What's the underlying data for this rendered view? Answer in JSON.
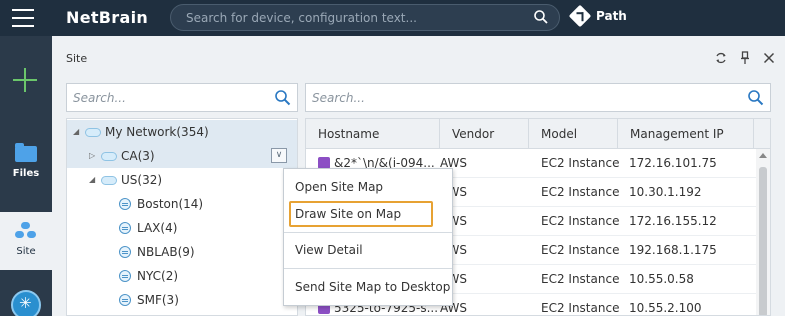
{
  "app": {
    "logo_text": "NetBrain"
  },
  "topbar": {
    "search_placeholder": "Search for device, configuration text...",
    "path_label": "Path"
  },
  "rail": {
    "files_label": "Files",
    "site_label": "Site"
  },
  "panel": {
    "title": "Site",
    "tree_search_placeholder": "Search...",
    "grid_search_placeholder": "Search..."
  },
  "tree": {
    "items": [
      {
        "label": "My Network(354)",
        "level": 0,
        "expanded": true,
        "selected": true
      },
      {
        "label": "CA(3)",
        "level": 1,
        "expanded": false,
        "selected": true
      },
      {
        "label": "US(32)",
        "level": 1,
        "expanded": true,
        "selected": false
      },
      {
        "label": "Boston(14)",
        "level": 2
      },
      {
        "label": "LAX(4)",
        "level": 2
      },
      {
        "label": "NBLAB(9)",
        "level": 2
      },
      {
        "label": "NYC(2)",
        "level": 2
      },
      {
        "label": "SMF(3)",
        "level": 2
      }
    ]
  },
  "grid": {
    "columns": [
      "Hostname",
      "Vendor",
      "Model",
      "Management IP"
    ],
    "rows": [
      [
        "&2*`\\n/&(i-094...",
        "AWS",
        "EC2 Instance",
        "172.16.101.75"
      ],
      [
        "",
        "AWS",
        "EC2 Instance",
        "10.30.1.192"
      ],
      [
        "",
        "AWS",
        "EC2 Instance",
        "172.16.155.12"
      ],
      [
        "",
        "AWS",
        "EC2 Instance",
        "192.168.1.175"
      ],
      [
        "",
        "AWS",
        "EC2 Instance",
        "10.55.0.58"
      ],
      [
        "5325-to-7925-s...",
        "AWS",
        "EC2 Instance",
        "10.55.2.100"
      ]
    ]
  },
  "context_menu": {
    "items": [
      "Open Site Map",
      "Draw Site on Map",
      "View Detail",
      "Send Site Map to Desktop"
    ],
    "highlighted": "Draw Site on Map",
    "accent_color": "#e7a233"
  }
}
